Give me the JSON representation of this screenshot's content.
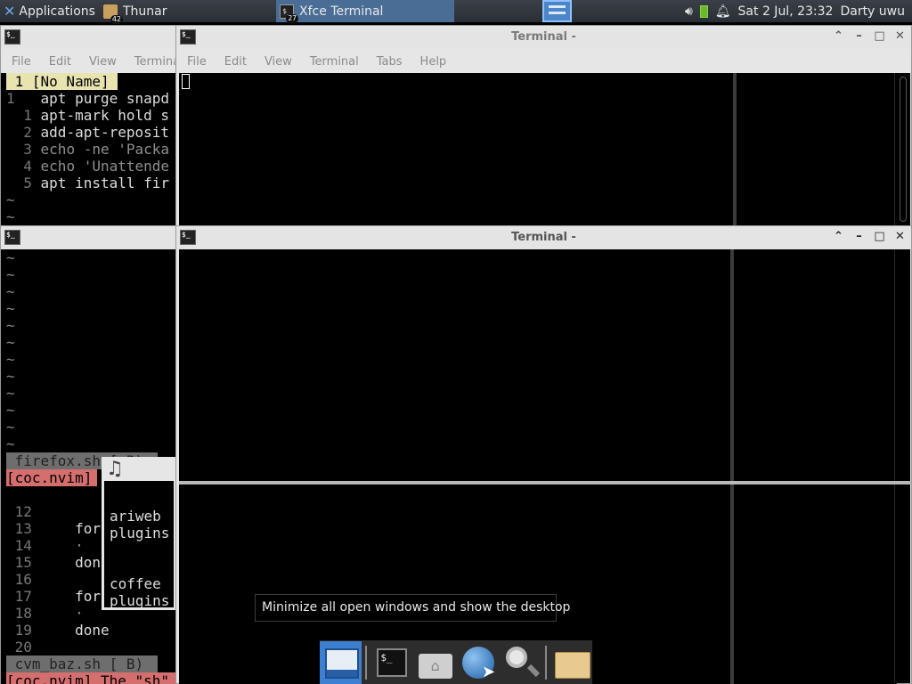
{
  "panel": {
    "applications": "Applications",
    "tasks": [
      {
        "label": "Thunar",
        "badge": "42"
      },
      {
        "label": "Xfce Terminal",
        "badge": "27"
      }
    ],
    "clock": "Sat  2 Jul, 23:32",
    "user": "Darty uwu"
  },
  "left_top_window": {
    "menu": [
      "File",
      "Edit",
      "View",
      "Termina"
    ]
  },
  "vim_top": {
    "tab": " 1 [No Name] ",
    "lines": [
      {
        "num": "1 ",
        "text": "  apt purge snapd"
      },
      {
        "num": "  1",
        "text": " apt-mark hold s"
      },
      {
        "num": "  2",
        "text": " add-apt-reposit"
      },
      {
        "num": "  3",
        "text": " echo -ne 'Packa"
      },
      {
        "num": "  4",
        "text": " echo 'Unattende"
      },
      {
        "num": "  5",
        "text": " apt install fir"
      }
    ],
    "tildes": [
      "~",
      "~"
    ]
  },
  "vim_mid": {
    "tildes": [
      "~",
      "~",
      "~",
      "~",
      "~",
      "~",
      "~",
      "~",
      "~",
      "~",
      "~",
      "~"
    ],
    "status_file": " firefox.sh [ B)",
    "status_coc": "[coc.nvim]"
  },
  "vim_bottom": {
    "lines": [
      {
        "num": " 12",
        "text": ""
      },
      {
        "num": " 13",
        "text": "     for"
      },
      {
        "num": " 14",
        "text": "     ·"
      },
      {
        "num": " 15",
        "text": "     done"
      },
      {
        "num": " 16",
        "text": ""
      },
      {
        "num": " 17",
        "text": "     for"
      },
      {
        "num": " 18",
        "text": "     ·"
      },
      {
        "num": " 19",
        "text": "     done"
      },
      {
        "num": " 20",
        "text": ""
      }
    ],
    "status_file": " cvm_baz.sh [ B)",
    "status_coc": "[coc.nvim] The \"sh\""
  },
  "music_window": {
    "lines": [
      "ariweb",
      "plugins",
      "",
      "",
      "coffee",
      "plugins"
    ]
  },
  "terminal_top": {
    "title": "Terminal -",
    "menu": [
      "File",
      "Edit",
      "View",
      "Terminal",
      "Tabs",
      "Help"
    ]
  },
  "terminal_main": {
    "title": "Terminal -"
  },
  "tooltip": "Minimize all open windows and show the desktop",
  "dock": {
    "items": [
      "show-desktop",
      "terminal",
      "home-folder",
      "web-browser",
      "search",
      "file-manager"
    ]
  }
}
